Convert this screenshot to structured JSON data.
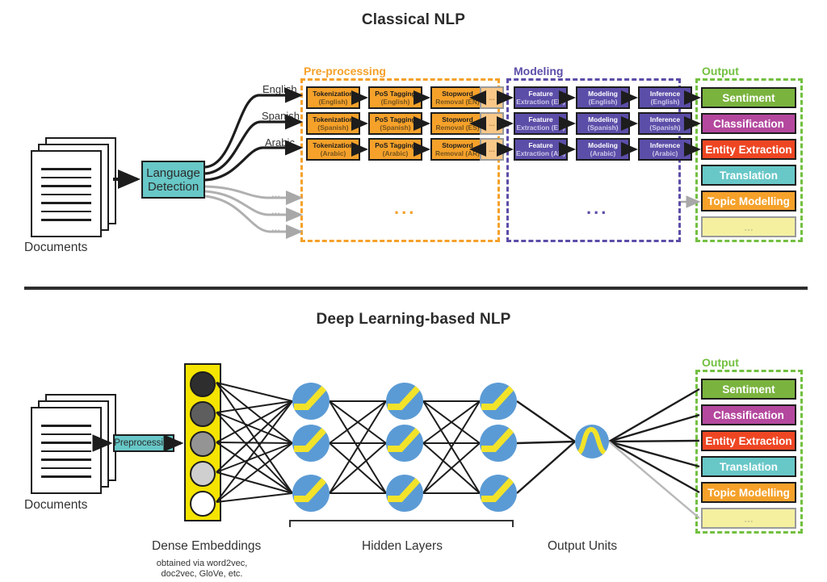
{
  "titles": {
    "classical": "Classical NLP",
    "deep": "Deep Learning-based NLP"
  },
  "colors": {
    "orange": "#f5a12a",
    "light_orange": "#f9c888",
    "purple": "#5b4ea8",
    "green": "#72c040",
    "teal": "#68c7c7",
    "yellow": "#f5e400",
    "node_blue": "#5b9bd5",
    "node_yellow": "#f2e32a",
    "sentiment": "#7ab33e",
    "classification": "#b4489e",
    "entity": "#ee4623",
    "translation": "#68c7c7",
    "topic": "#f5a12a",
    "ellipsis": "#f5f0a0"
  },
  "classical": {
    "documents_label": "Documents",
    "language_detection": {
      "line1": "Language",
      "line2": "Detection"
    },
    "branch_labels": [
      "English",
      "Spanish",
      "Arabic"
    ],
    "faded_branch_labels": [
      "...",
      "...",
      "..."
    ],
    "groups": {
      "preprocessing": "Pre-processing",
      "modeling": "Modeling",
      "output": "Output"
    },
    "preprocessing_ellipsis": "...",
    "modeling_ellipsis": "...",
    "rows": [
      {
        "lang": "English",
        "stages": [
          {
            "title": "Tokenization",
            "sub": "(English)"
          },
          {
            "title": "PoS Tagging",
            "sub": "(English)"
          },
          {
            "title": "Stopword",
            "sub": "Removal (EN)"
          },
          {
            "title": "...",
            "sub": ""
          }
        ],
        "model_stages": [
          {
            "title": "Feature",
            "sub": "Extraction (EN)"
          },
          {
            "title": "Modeling",
            "sub": "(English)"
          },
          {
            "title": "Inference",
            "sub": "(English)"
          }
        ]
      },
      {
        "lang": "Spanish",
        "stages": [
          {
            "title": "Tokenization",
            "sub": "(Spanish)"
          },
          {
            "title": "PoS Tagging",
            "sub": "(Spanish)"
          },
          {
            "title": "Stopword",
            "sub": "Removal (ES)"
          },
          {
            "title": "...",
            "sub": ""
          }
        ],
        "model_stages": [
          {
            "title": "Feature",
            "sub": "Extraction (ES)"
          },
          {
            "title": "Modeling",
            "sub": "(Spanish)"
          },
          {
            "title": "Inference",
            "sub": "(Spanish)"
          }
        ]
      },
      {
        "lang": "Arabic",
        "stages": [
          {
            "title": "Tokenization",
            "sub": "(Arabic)"
          },
          {
            "title": "PoS Tagging",
            "sub": "(Arabic)"
          },
          {
            "title": "Stopword",
            "sub": "Removal (AR)"
          },
          {
            "title": "...",
            "sub": ""
          }
        ],
        "model_stages": [
          {
            "title": "Feature",
            "sub": "Extraction (AR)"
          },
          {
            "title": "Modeling",
            "sub": "(Arabic)"
          },
          {
            "title": "Inference",
            "sub": "(Arabic)"
          }
        ]
      }
    ],
    "outputs": [
      {
        "label": "Sentiment",
        "color": "#7ab33e"
      },
      {
        "label": "Classification",
        "color": "#b4489e"
      },
      {
        "label": "Entity Extraction",
        "color": "#ee4623"
      },
      {
        "label": "Translation",
        "color": "#68c7c7"
      },
      {
        "label": "Topic Modelling",
        "color": "#f5a12a"
      },
      {
        "label": "...",
        "color": "#f5f0a0"
      }
    ]
  },
  "deep": {
    "documents_label": "Documents",
    "preprocessing_label": "Preprocessing",
    "dense_embeddings_label": "Dense Embeddings",
    "dense_embeddings_note_1": "obtained via word2vec,",
    "dense_embeddings_note_2": "doc2vec, GloVe, etc.",
    "hidden_layers_label": "Hidden Layers",
    "output_units_label": "Output Units",
    "output_group_label": "Output",
    "embedding_shades": [
      "#2e2e2e",
      "#5e5e5e",
      "#949494",
      "#cfcfcf",
      "#ffffff"
    ],
    "outputs": [
      {
        "label": "Sentiment",
        "color": "#7ab33e"
      },
      {
        "label": "Classification",
        "color": "#b4489e"
      },
      {
        "label": "Entity Extraction",
        "color": "#ee4623"
      },
      {
        "label": "Translation",
        "color": "#68c7c7"
      },
      {
        "label": "Topic Modelling",
        "color": "#f5a12a"
      },
      {
        "label": "...",
        "color": "#f5f0a0"
      }
    ]
  }
}
